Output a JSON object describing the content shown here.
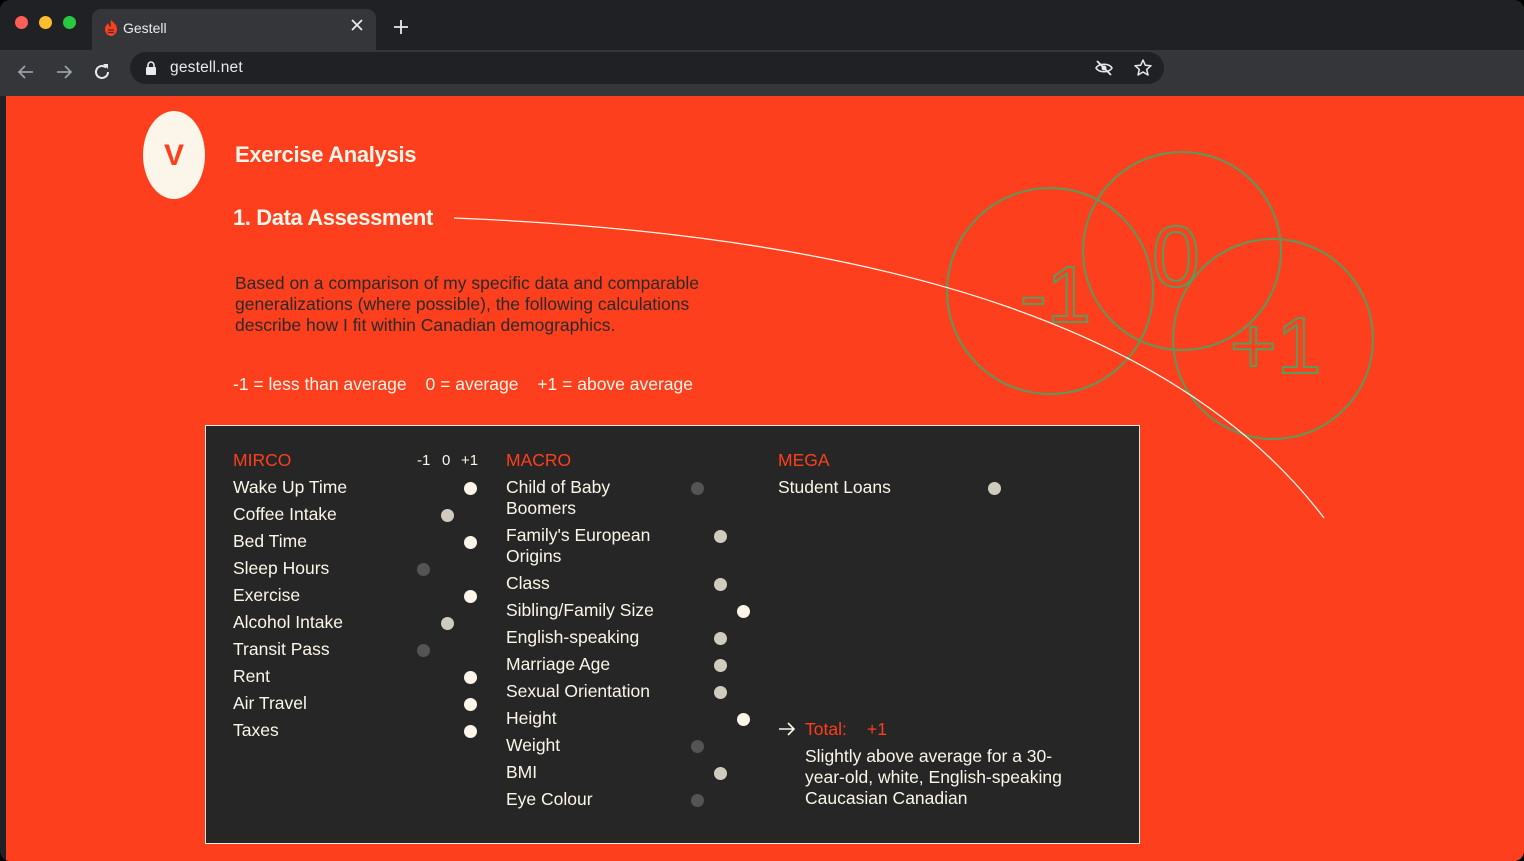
{
  "browser": {
    "tab_title": "Gestell",
    "url": "gestell.net"
  },
  "colors": {
    "page_background": "#fd3f1d",
    "panel_background": "#262626",
    "accent_text": "#fd3f1d",
    "cream": "#fbf6e9",
    "circle_stroke": "#5a9a5a"
  },
  "section": {
    "badge": "V",
    "title": "Exercise Analysis",
    "subtitle": "1. Data Assessment",
    "intro": "Based on a comparison of my specific data and comparable generalizations (where possible), the following calculations describe how I fit within Canadian demographics.",
    "legend": [
      "-1 = less than average",
      "0 = average",
      "+1 = above average"
    ],
    "circle_labels": [
      "-1",
      "0",
      "+1"
    ]
  },
  "panel": {
    "scale_labels": [
      "-1",
      "0",
      "+1"
    ],
    "micro": {
      "heading": "MIRCO",
      "items": [
        {
          "label": "Wake Up Time",
          "score": 1
        },
        {
          "label": "Coffee Intake",
          "score": 0
        },
        {
          "label": "Bed Time",
          "score": 1
        },
        {
          "label": "Sleep Hours",
          "score": -1
        },
        {
          "label": "Exercise",
          "score": 1
        },
        {
          "label": "Alcohol Intake",
          "score": 0
        },
        {
          "label": "Transit Pass",
          "score": -1
        },
        {
          "label": "Rent",
          "score": 1
        },
        {
          "label": "Air Travel",
          "score": 1
        },
        {
          "label": "Taxes",
          "score": 1
        }
      ]
    },
    "macro": {
      "heading": "MACRO",
      "items": [
        {
          "label": "Child of Baby Boomers",
          "score": -1
        },
        {
          "label": "Family's European Origins",
          "score": 0
        },
        {
          "label": "Class",
          "score": 0
        },
        {
          "label": "Sibling/Family Size",
          "score": 1
        },
        {
          "label": "English-speaking",
          "score": 0
        },
        {
          "label": "Marriage Age",
          "score": 0
        },
        {
          "label": "Sexual Orientation",
          "score": 0
        },
        {
          "label": "Height",
          "score": 1
        },
        {
          "label": "Weight",
          "score": -1
        },
        {
          "label": "BMI",
          "score": 0
        },
        {
          "label": "Eye Colour",
          "score": -1
        }
      ]
    },
    "mega": {
      "heading": "MEGA",
      "items": [
        {
          "label": "Student Loans",
          "score": 0
        }
      ]
    },
    "total": {
      "label": "Total:",
      "value": "+1",
      "description": "Slightly above average for a 30-year-old, white, English-speaking Caucasian Canadian"
    }
  }
}
